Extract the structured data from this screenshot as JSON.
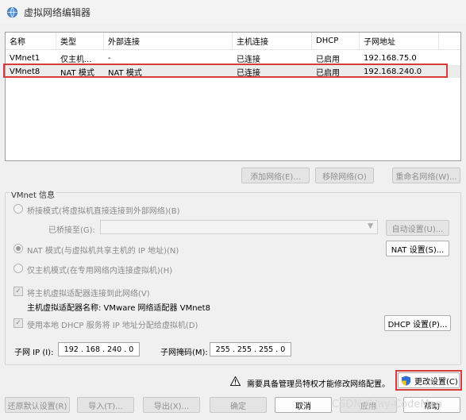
{
  "window": {
    "title": "虚拟网络编辑器"
  },
  "network_table": {
    "columns": [
      "名称",
      "类型",
      "外部连接",
      "主机连接",
      "DHCP",
      "子网地址"
    ],
    "rows": [
      {
        "name": "VMnet1",
        "type": "仅主机...",
        "external": "-",
        "host": "已连接",
        "dhcp": "已启用",
        "subnet": "192.168.75.0"
      },
      {
        "name": "VMnet8",
        "type": "NAT 模式",
        "external": "NAT 模式",
        "host": "已连接",
        "dhcp": "已启用",
        "subnet": "192.168.240.0"
      }
    ]
  },
  "list_buttons": {
    "add": "添加网络(E)...",
    "remove": "移除网络(O)",
    "rename": "重命名网络(W)..."
  },
  "vmnet_info": {
    "title": "VMnet 信息",
    "bridged_label": "桥接模式(将虚拟机直接连接到外部网络)(B)",
    "bridged_to_label": "已桥接至(G):",
    "auto_settings": "自动设置(U)...",
    "nat_label": "NAT 模式(与虚拟机共享主机的 IP 地址)(N)",
    "nat_settings": "NAT 设置(S)...",
    "hostonly_label": "仅主机模式(在专用网络内连接虚拟机)(H)",
    "connect_adapter_label": "将主机虚拟适配器连接到此网络(V)",
    "adapter_name_label": "主机虚拟适配器名称: VMware 网络适配器 VMnet8",
    "dhcp_label": "使用本地 DHCP 服务将 IP 地址分配给虚拟机(D)",
    "dhcp_settings": "DHCP 设置(P)...",
    "subnet_ip_label": "子网 IP (I):",
    "subnet_ip": [
      "192",
      "168",
      "240",
      "0"
    ],
    "subnet_mask_label": "子网掩码(M):",
    "subnet_mask": [
      "255",
      "255",
      "255",
      "0"
    ]
  },
  "admin_notice": "需要具备管理员特权才能修改网络配置。",
  "change_settings": "更改设置(C)",
  "footer": {
    "restore": "还原默认设置(R)",
    "import": "导入(T)...",
    "export": "导出(X)...",
    "ok": "确定",
    "cancel": "取消",
    "apply": "应用",
    "help": "帮助"
  },
  "watermark": "CSDN @Jay-CodeMan",
  "colors": {
    "highlight": "#d93a3a",
    "window_bg": "#f0f0f0"
  }
}
